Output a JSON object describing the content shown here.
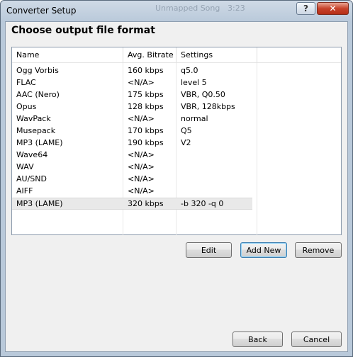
{
  "window": {
    "title": "Converter Setup",
    "ghost_title_fragments": [
      "Unmapped Song",
      "3:23"
    ]
  },
  "header": {
    "heading": "Choose output file format"
  },
  "table": {
    "columns": [
      "Name",
      "Avg. Bitrate",
      "Settings"
    ],
    "rows": [
      {
        "name": "Ogg Vorbis",
        "bitrate": "160 kbps",
        "settings": "q5.0"
      },
      {
        "name": "FLAC",
        "bitrate": "<N/A>",
        "settings": "level 5"
      },
      {
        "name": "AAC (Nero)",
        "bitrate": "175 kbps",
        "settings": "VBR, Q0.50"
      },
      {
        "name": "Opus",
        "bitrate": "128 kbps",
        "settings": "VBR, 128kbps"
      },
      {
        "name": "WavPack",
        "bitrate": "<N/A>",
        "settings": "normal"
      },
      {
        "name": "Musepack",
        "bitrate": "170 kbps",
        "settings": "Q5"
      },
      {
        "name": "MP3 (LAME)",
        "bitrate": "190 kbps",
        "settings": "V2"
      },
      {
        "name": "Wave64",
        "bitrate": "<N/A>",
        "settings": ""
      },
      {
        "name": "WAV",
        "bitrate": "<N/A>",
        "settings": ""
      },
      {
        "name": "AU/SND",
        "bitrate": "<N/A>",
        "settings": ""
      },
      {
        "name": "AIFF",
        "bitrate": "<N/A>",
        "settings": ""
      },
      {
        "name": "MP3 (LAME)",
        "bitrate": "320 kbps",
        "settings": "-b 320 -q 0",
        "selected": true
      }
    ]
  },
  "actions": {
    "edit": "Edit",
    "add_new": "Add New",
    "remove": "Remove"
  },
  "footer": {
    "back": "Back",
    "cancel": "Cancel"
  },
  "titlebar_buttons": {
    "help": "?",
    "close": "✕"
  },
  "colors": {
    "frame": "#b9c9da",
    "close_button": "#c7432b",
    "focus_border": "#3c7fb1"
  }
}
